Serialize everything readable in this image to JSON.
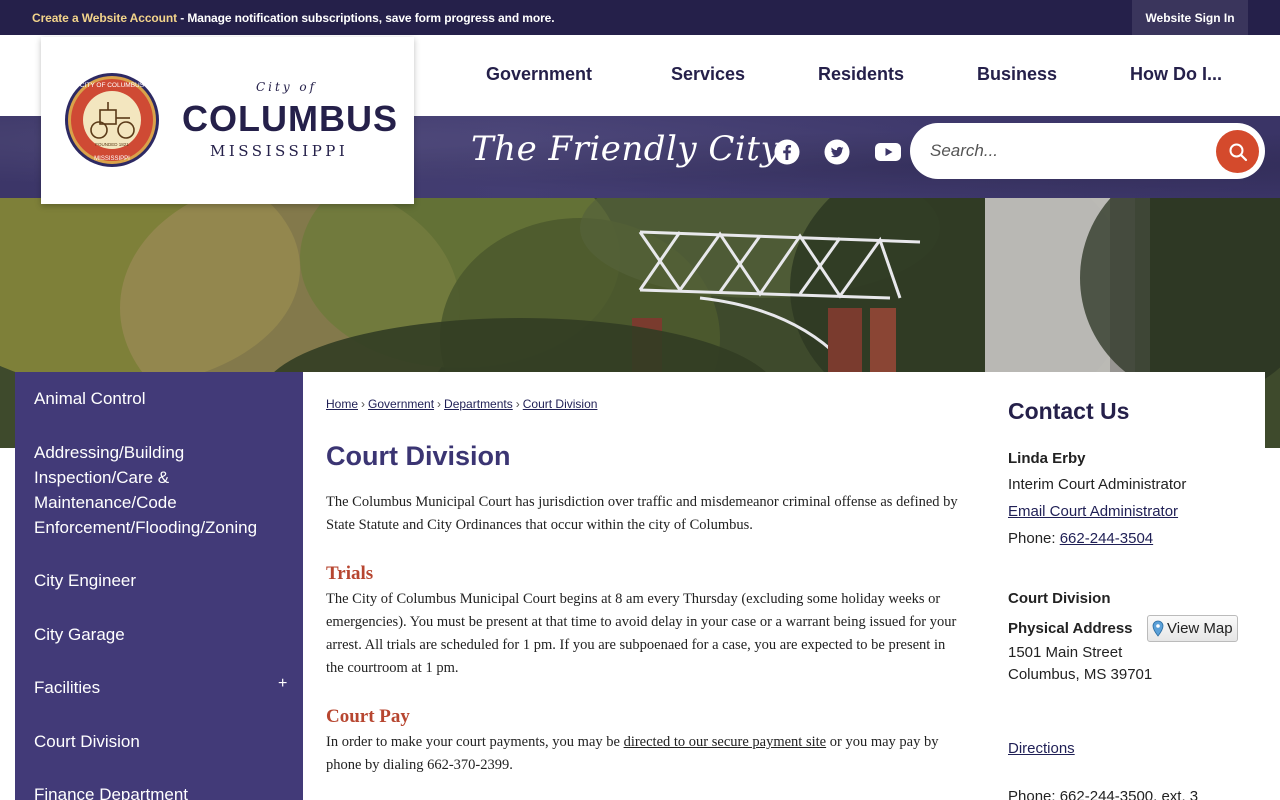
{
  "topbar": {
    "create_account": "Create a Website Account",
    "message": " - Manage notification subscriptions, save form progress and more.",
    "sign_in": "Website Sign In"
  },
  "logo": {
    "city_of": "City of",
    "name": "COLUMBUS",
    "state": "MISSISSIPPI",
    "seal_top_text": "CITY OF COLUMBUS",
    "seal_founded": "FOUNDED 1821",
    "seal_bottom_text": "MISSISSIPPI"
  },
  "nav": {
    "items": [
      "Government",
      "Services",
      "Residents",
      "Business",
      "How Do I..."
    ]
  },
  "banner": {
    "tagline": "The Friendly City",
    "social_icons": [
      "facebook-icon",
      "twitter-icon",
      "youtube-icon"
    ]
  },
  "search": {
    "placeholder": "Search..."
  },
  "sidebar": {
    "items": [
      {
        "label": "Animal Control"
      },
      {
        "label": "Addressing/Building Inspection/Care & Maintenance/Code Enforcement/Flooding/Zoning"
      },
      {
        "label": "City Engineer"
      },
      {
        "label": "City Garage"
      },
      {
        "label": "Facilities",
        "expand": "+"
      },
      {
        "label": "Court Division"
      },
      {
        "label": "Finance Department"
      }
    ]
  },
  "breadcrumb": [
    "Home",
    "Government",
    "Departments",
    "Court Division"
  ],
  "main": {
    "title": "Court Division",
    "intro": "The Columbus Municipal Court has jurisdiction over traffic and misdemeanor criminal offense as defined by State Statute and City Ordinances that occur within the city of Columbus.",
    "trials_heading": "Trials",
    "trials_text": "The City of Columbus Municipal Court begins at 8 am every Thursday (excluding some holiday weeks or emergencies). You must be present at that time to avoid delay in your case or a warrant being issued for your arrest. All trials are scheduled for 1 pm. If you are subpoenaed for a case, you are expected to be present in the courtroom at 1 pm.",
    "courtpay_heading": "Court Pay",
    "courtpay_before": "In order to make your court payments, you may be ",
    "courtpay_link": "directed to our secure payment site",
    "courtpay_after": " or you may pay by phone by dialing 662-370-2399."
  },
  "contact": {
    "title": "Contact Us",
    "name": "Linda Erby",
    "role": "Interim Court Administrator",
    "email_link": "Email Court Administrator",
    "phone_label": "Phone: ",
    "phone": "662-244-3504",
    "dept": "Court Division",
    "address_label": "Physical Address",
    "view_map": "View Map",
    "street": "1501 Main Street",
    "city": "Columbus, MS 39701",
    "directions": "Directions",
    "phone2": "Phone: 662-244-3500, ext. 3"
  },
  "colors": {
    "topbar": "#25204a",
    "sidebar": "#423a78",
    "title": "#3b3573",
    "section_heading": "#b74630",
    "search_button": "#d44a2c"
  }
}
